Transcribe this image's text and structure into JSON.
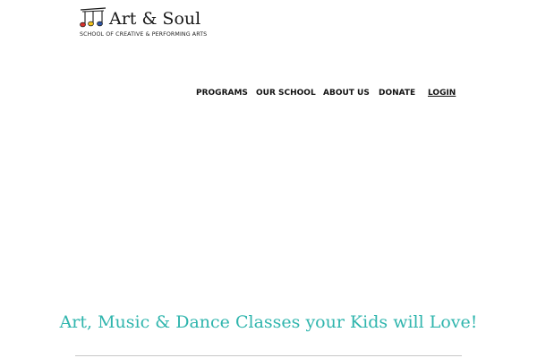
{
  "logo": {
    "title": "Art & Soul",
    "tagline": "SCHOOL OF CREATIVE & PERFORMING ARTS"
  },
  "nav": {
    "programs": "PROGRAMS",
    "our_school": "OUR SCHOOL",
    "about_us": "ABOUT US",
    "donate": "DONATE",
    "login": "LOGIN"
  },
  "hero": {
    "headline": "Art, Music & Dance Classes your Kids will Love!"
  },
  "colors": {
    "accent": "#2fb5ad",
    "note_red": "#d6312b",
    "note_yellow": "#f2c21b",
    "note_blue": "#2f56a6"
  }
}
